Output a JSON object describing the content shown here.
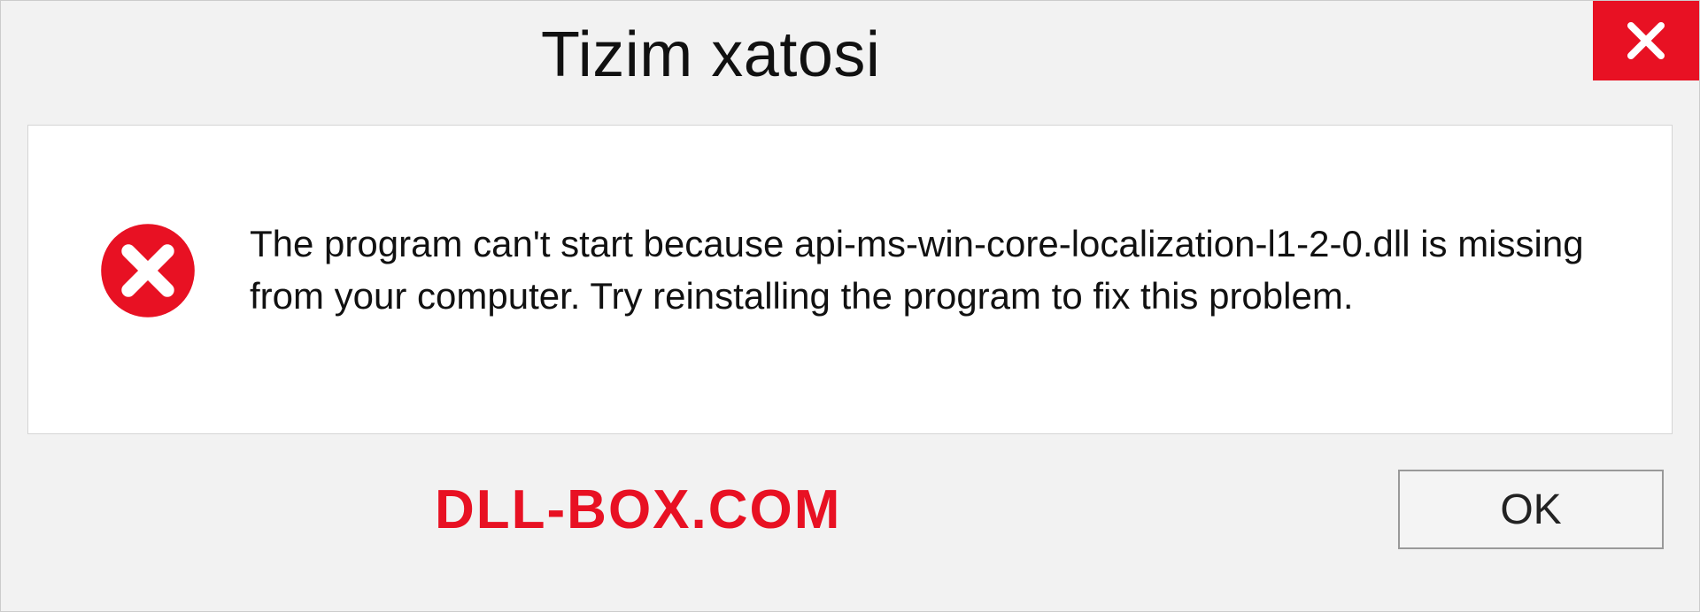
{
  "dialog": {
    "title": "Tizim xatosi",
    "message": "The program can't start because api-ms-win-core-localization-l1-2-0.dll is missing from your computer. Try reinstalling the program to fix this problem."
  },
  "footer": {
    "watermark": "DLL-BOX.COM",
    "ok_label": "OK"
  }
}
